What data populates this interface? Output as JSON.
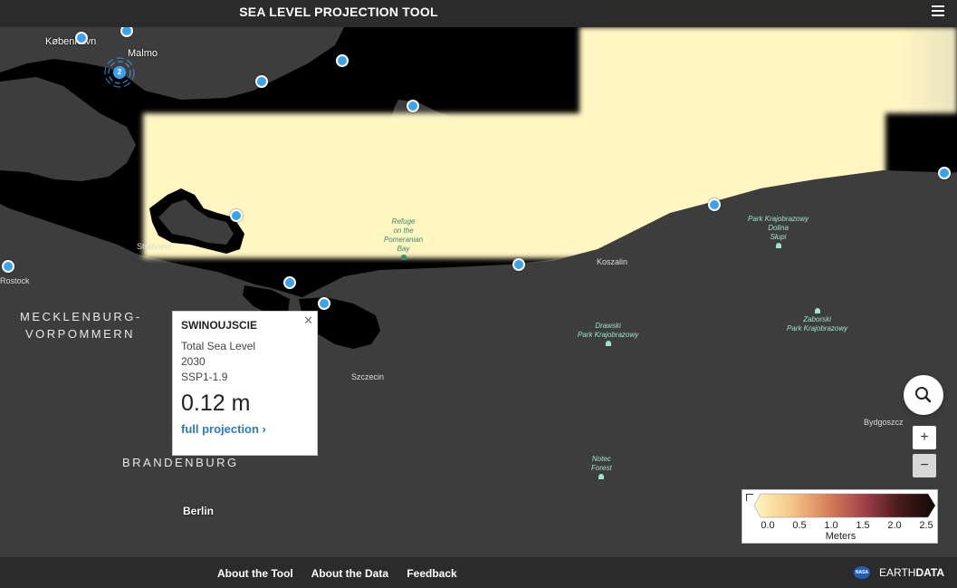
{
  "header": {
    "title": "SEA LEVEL PROJECTION TOOL",
    "menu_icon": "hamburger-menu-icon"
  },
  "map": {
    "labels": {
      "kobenhavn": "København",
      "malmo": "Malmo",
      "stralsund": "Stralsund",
      "rostock": "Rostock",
      "mecklenburg_1": "MECKLENBURG-",
      "mecklenburg_2": "VORPOMMERN",
      "brandenburg": "BRANDENBURG",
      "berlin": "Berlin",
      "szczecin": "Szczecin",
      "koszalin": "Koszalin",
      "bydgoszcz": "Bydgoszcz"
    },
    "parks": {
      "pomeranian_1": "Refuge",
      "pomeranian_2": "on the",
      "pomeranian_3": "Pomeranian",
      "pomeranian_4": "Bay",
      "drawski_1": "Drawski",
      "drawski_2": "Park Krajobrazowy",
      "dolina_1": "Park Krajobrazowy",
      "dolina_2": "Dolina",
      "dolina_3": "Słupi",
      "zaborski_1": "Zaborski",
      "zaborski_2": "Park Krajobrazowy",
      "notec_1": "Notec",
      "notec_2": "Forest"
    },
    "cluster_count": "2",
    "colors": {
      "land": "#3d3d3d",
      "water": "#000000",
      "projection_fill": "#fff6c2",
      "marker": "#3aa3f0"
    }
  },
  "popup": {
    "station": "SWINOUJSCIE",
    "metric": "Total Sea Level",
    "year": "2030",
    "scenario": "SSP1-1.9",
    "value": "0.12 m",
    "link": "full projection ›",
    "close_icon": "close-icon"
  },
  "controls": {
    "search_icon": "search-icon",
    "zoom_in": "+",
    "zoom_out": "−"
  },
  "legend": {
    "ticks": [
      "0.0",
      "0.5",
      "1.0",
      "1.5",
      "2.0",
      "2.5"
    ],
    "unit": "Meters",
    "gradient": [
      "#fff6c2",
      "#f5c98a",
      "#d9835a",
      "#a4434a",
      "#4a1a1a",
      "#0d0a06"
    ]
  },
  "footer": {
    "links": [
      "About the Tool",
      "About the Data",
      "Feedback"
    ],
    "brand_1": "EARTH",
    "brand_2": "DATA",
    "logo": "NASA"
  }
}
